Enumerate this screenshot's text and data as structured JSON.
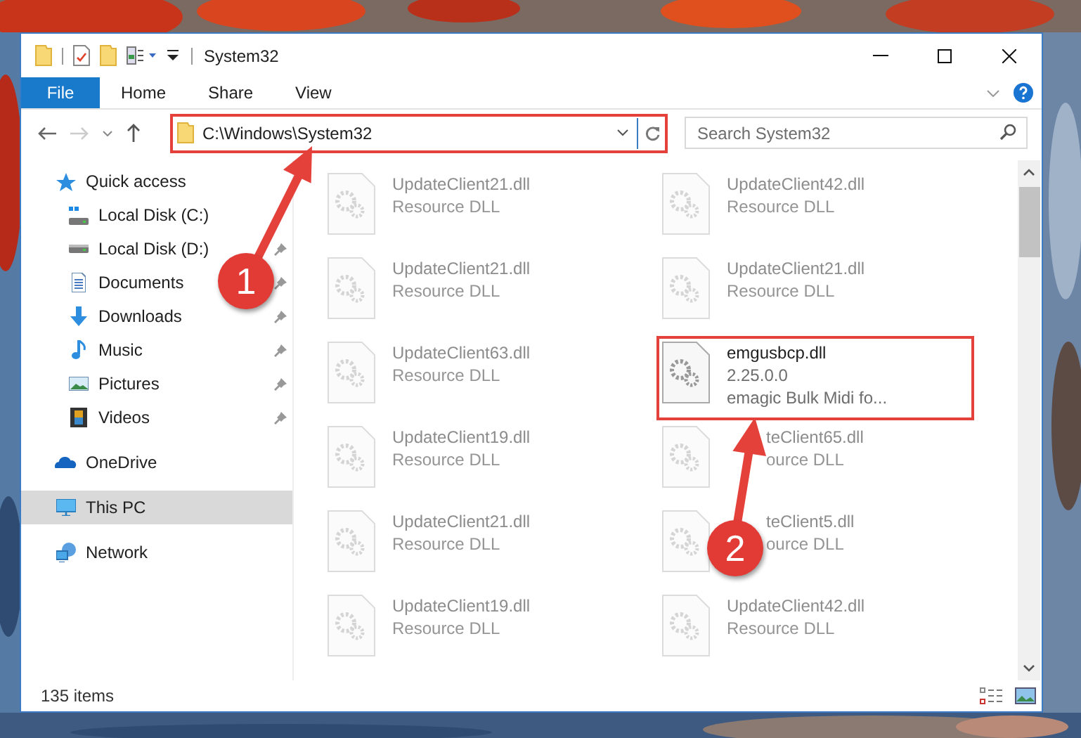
{
  "window": {
    "title": "System32"
  },
  "ribbon_tabs": [
    {
      "label": "File",
      "kind": "backstage"
    },
    {
      "label": "Home",
      "kind": "tab",
      "selected": false
    },
    {
      "label": "Share",
      "kind": "tab",
      "selected": false
    },
    {
      "label": "View",
      "kind": "tab",
      "selected": false
    }
  ],
  "address_bar": {
    "value": "C:\\Windows\\System32",
    "highlighted": true
  },
  "search": {
    "placeholder": "Search System32"
  },
  "sidebar": {
    "items": [
      {
        "label": "Quick access",
        "kind": "star",
        "selected": false,
        "children": [
          {
            "label": "Local Disk (C:)",
            "kind": "system-drive",
            "pinned": false,
            "selected": false
          },
          {
            "label": "Local Disk (D:)",
            "kind": "drive",
            "pinned": true,
            "selected": false
          },
          {
            "label": "Documents",
            "kind": "document",
            "pinned": true,
            "selected": false
          },
          {
            "label": "Downloads",
            "kind": "download",
            "pinned": true,
            "selected": false
          },
          {
            "label": "Music",
            "kind": "music",
            "pinned": true,
            "selected": false
          },
          {
            "label": "Pictures",
            "kind": "pictures",
            "pinned": true,
            "selected": false
          },
          {
            "label": "Videos",
            "kind": "video",
            "pinned": true,
            "selected": false
          }
        ]
      },
      {
        "label": "OneDrive",
        "kind": "cloud",
        "selected": false
      },
      {
        "label": "This PC",
        "kind": "computer",
        "selected": true
      },
      {
        "label": "Network",
        "kind": "network",
        "selected": false
      }
    ]
  },
  "files": [
    {
      "name": "UpdateClient21.dll",
      "details": [
        "Resource DLL"
      ],
      "blurred": true,
      "highlighted": false,
      "start_hidden": false
    },
    {
      "name": "UpdateClient42.dll",
      "details": [
        "Resource DLL"
      ],
      "blurred": true,
      "highlighted": false,
      "start_hidden": false
    },
    {
      "name": "UpdateClient21.dll",
      "details": [
        "Resource DLL"
      ],
      "blurred": true,
      "highlighted": false,
      "start_hidden": false
    },
    {
      "name": "UpdateClient21.dll",
      "details": [
        "Resource DLL"
      ],
      "blurred": true,
      "highlighted": false,
      "start_hidden": false
    },
    {
      "name": "UpdateClient63.dll",
      "details": [
        "Resource DLL"
      ],
      "blurred": true,
      "highlighted": false,
      "start_hidden": false
    },
    {
      "name": "emgusbcp.dll",
      "details": [
        "2.25.0.0",
        "emagic Bulk Midi fo..."
      ],
      "blurred": false,
      "highlighted": true,
      "start_hidden": false
    },
    {
      "name": "UpdateClient19.dll",
      "details": [
        "Resource DLL"
      ],
      "blurred": true,
      "highlighted": false,
      "start_hidden": false
    },
    {
      "name": "teClient65.dll",
      "details": [
        "ource DLL"
      ],
      "blurred": true,
      "highlighted": false,
      "start_hidden": true
    },
    {
      "name": "UpdateClient21.dll",
      "details": [
        "Resource DLL"
      ],
      "blurred": true,
      "highlighted": false,
      "start_hidden": false
    },
    {
      "name": "teClient5.dll",
      "details": [
        "ource DLL"
      ],
      "blurred": true,
      "highlighted": false,
      "start_hidden": true
    },
    {
      "name": "UpdateClient19.dll",
      "details": [
        "Resource DLL"
      ],
      "blurred": true,
      "highlighted": false,
      "start_hidden": false
    },
    {
      "name": "UpdateClient42.dll",
      "details": [
        "Resource DLL"
      ],
      "blurred": true,
      "highlighted": false,
      "start_hidden": false
    }
  ],
  "status_bar": {
    "item_count": "135 items"
  },
  "callouts": [
    {
      "number": "1"
    },
    {
      "number": "2"
    }
  ]
}
